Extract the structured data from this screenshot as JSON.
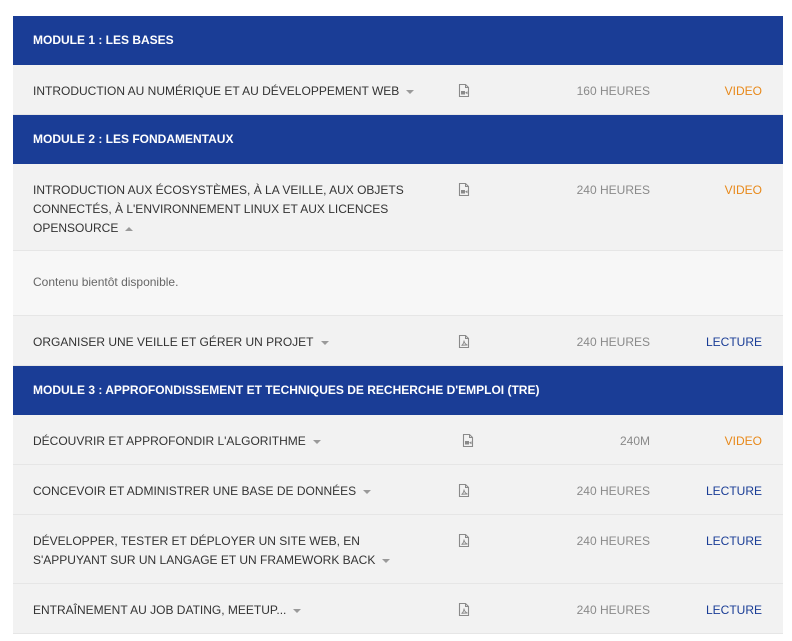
{
  "modules": [
    {
      "title": "MODULE 1 : LES BASES",
      "lessons": [
        {
          "title": "INTRODUCTION AU NUMÉRIQUE ET AU DÉVELOPPEMENT WEB",
          "duration": "160 HEURES",
          "type": "VIDEO",
          "icon": "video-file-icon"
        }
      ]
    },
    {
      "title": "MODULE 2 : LES FONDAMENTAUX",
      "lessons": [
        {
          "title": "INTRODUCTION AUX ÉCOSYSTÈMES, À LA VEILLE, AUX OBJETS CONNECTÉS, À L'ENVIRONNEMENT LINUX ET AUX LICENCES OPENSOURCE",
          "duration": "240 HEURES",
          "type": "VIDEO",
          "icon": "video-file-icon",
          "expanded_content": "Contenu bientôt disponible."
        },
        {
          "title": "ORGANISER UNE VEILLE ET GÉRER UN PROJET",
          "duration": "240 HEURES",
          "type": "LECTURE",
          "icon": "pdf-file-icon"
        }
      ]
    },
    {
      "title": "MODULE 3 : APPROFONDISSEMENT ET TECHNIQUES DE RECHERCHE D'EMPLOI (TRE)",
      "lessons": [
        {
          "title": "DÉCOUVRIR ET APPROFONDIR L'ALGORITHME",
          "duration": "240M",
          "type": "VIDEO",
          "icon": "video-file-icon"
        },
        {
          "title": "CONCEVOIR ET ADMINISTRER UNE BASE DE DONNÉES",
          "duration": "240 HEURES",
          "type": "LECTURE",
          "icon": "pdf-file-icon"
        },
        {
          "title": "DÉVELOPPER, TESTER ET DÉPLOYER UN SITE WEB, EN S'APPUYANT SUR UN LANGAGE ET UN FRAMEWORK BACK",
          "duration": "240 HEURES",
          "type": "LECTURE",
          "icon": "pdf-file-icon"
        },
        {
          "title": "ENTRAÎNEMENT AU JOB DATING, MEETUP...",
          "duration": "240 HEURES",
          "type": "LECTURE",
          "icon": "pdf-file-icon"
        }
      ]
    }
  ],
  "colors": {
    "module_header_bg": "#1a3d96",
    "video_accent": "#e8891a",
    "reading_accent": "#1a3d96"
  }
}
